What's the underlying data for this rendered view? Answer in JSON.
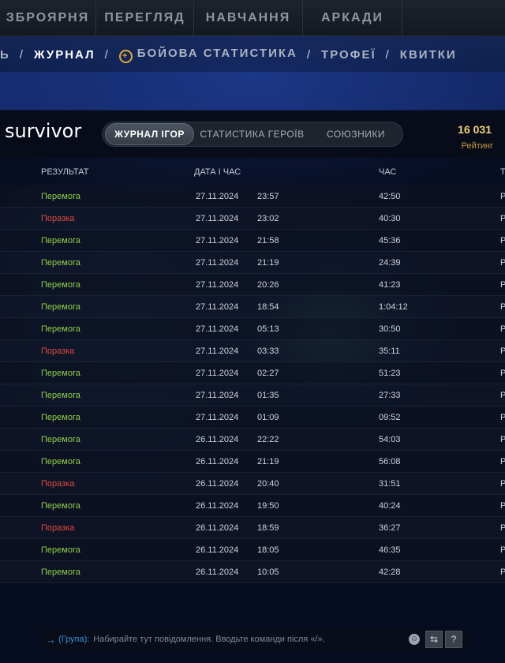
{
  "top_nav": {
    "tabs": [
      "ЗБРОЯРНЯ",
      "ПЕРЕГЛЯД",
      "НАВЧАННЯ",
      "АРКАДИ"
    ]
  },
  "sub_nav": {
    "partial_left": "Ь",
    "items": [
      "ЖУРНАЛ",
      "БОЙОВА СТАТИСТИКА",
      "ТРОФЕЇ",
      "КВИТКИ"
    ],
    "active": "ЖУРНАЛ"
  },
  "profile": {
    "player_name": "survivor",
    "tabs": [
      "ЖУРНАЛ ІГОР",
      "СТАТИСТИКА ГЕРОЇВ",
      "СОЮЗНИКИ"
    ],
    "active_tab": "ЖУРНАЛ ІГОР",
    "rating_value": "16 031",
    "rating_label": "Рейтинг"
  },
  "table": {
    "columns": {
      "result": "РЕЗУЛЬТАТ",
      "date_time": "ДАТА І ЧАС",
      "duration": "ЧАС",
      "partial": "Т"
    },
    "rows": [
      {
        "result": "Перемога",
        "win": true,
        "date": "27.11.2024",
        "time": "23:57",
        "duration": "42:50",
        "partial": "Р"
      },
      {
        "result": "Поразка",
        "win": false,
        "date": "27.11.2024",
        "time": "23:02",
        "duration": "40:30",
        "partial": "Р"
      },
      {
        "result": "Перемога",
        "win": true,
        "date": "27.11.2024",
        "time": "21:58",
        "duration": "45:36",
        "partial": "Р"
      },
      {
        "result": "Перемога",
        "win": true,
        "date": "27.11.2024",
        "time": "21:19",
        "duration": "24:39",
        "partial": "Р"
      },
      {
        "result": "Перемога",
        "win": true,
        "date": "27.11.2024",
        "time": "20:26",
        "duration": "41:23",
        "partial": "Р"
      },
      {
        "result": "Перемога",
        "win": true,
        "date": "27.11.2024",
        "time": "18:54",
        "duration": "1:04:12",
        "partial": "Р"
      },
      {
        "result": "Перемога",
        "win": true,
        "date": "27.11.2024",
        "time": "05:13",
        "duration": "30:50",
        "partial": "Р"
      },
      {
        "result": "Поразка",
        "win": false,
        "date": "27.11.2024",
        "time": "03:33",
        "duration": "35:11",
        "partial": "Р"
      },
      {
        "result": "Перемога",
        "win": true,
        "date": "27.11.2024",
        "time": "02:27",
        "duration": "51:23",
        "partial": "Р"
      },
      {
        "result": "Перемога",
        "win": true,
        "date": "27.11.2024",
        "time": "01:35",
        "duration": "27:33",
        "partial": "Р"
      },
      {
        "result": "Перемога",
        "win": true,
        "date": "27.11.2024",
        "time": "01:09",
        "duration": "09:52",
        "partial": "Р"
      },
      {
        "result": "Перемога",
        "win": true,
        "date": "26.11.2024",
        "time": "22:22",
        "duration": "54:03",
        "partial": "Р"
      },
      {
        "result": "Перемога",
        "win": true,
        "date": "26.11.2024",
        "time": "21:19",
        "duration": "56:08",
        "partial": "Р"
      },
      {
        "result": "Поразка",
        "win": false,
        "date": "26.11.2024",
        "time": "20:40",
        "duration": "31:51",
        "partial": "Р"
      },
      {
        "result": "Перемога",
        "win": true,
        "date": "26.11.2024",
        "time": "19:50",
        "duration": "40:24",
        "partial": "Р"
      },
      {
        "result": "Поразка",
        "win": false,
        "date": "26.11.2024",
        "time": "18:59",
        "duration": "36:27",
        "partial": "Р"
      },
      {
        "result": "Перемога",
        "win": true,
        "date": "26.11.2024",
        "time": "18:05",
        "duration": "46:35",
        "partial": "Р"
      },
      {
        "result": "Перемога",
        "win": true,
        "date": "26.11.2024",
        "time": "10:05",
        "duration": "42:28",
        "partial": "Р"
      }
    ]
  },
  "chat": {
    "arrow": "→",
    "channel": "(Група):",
    "placeholder": "Набирайте тут повідомлення. Вводьте команди після «/».",
    "help_label": "?"
  },
  "colors": {
    "win": "#8fcf48",
    "loss": "#e14a3c",
    "rating": "#efd27a",
    "channel": "#3b8fd8"
  },
  "icons": [
    "plus-star-icon",
    "emoji-icon",
    "attach-icon",
    "help-icon"
  ]
}
